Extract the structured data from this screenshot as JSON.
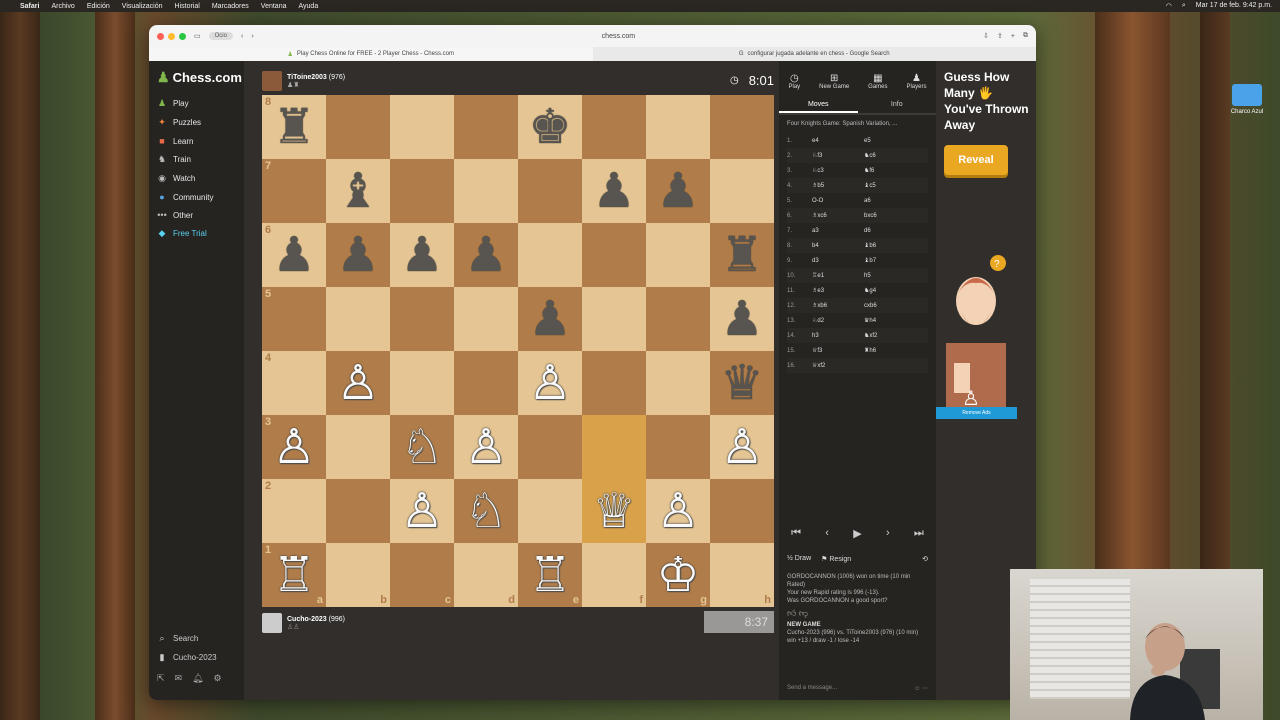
{
  "menubar": {
    "app": "Safari",
    "items": [
      "Archivo",
      "Edición",
      "Visualización",
      "Historial",
      "Marcadores",
      "Ventana",
      "Ayuda"
    ],
    "datetime": "Mar 17 de feb. 9:42 p.m."
  },
  "desktop": {
    "folder_label": "Charco Azul"
  },
  "browser": {
    "profile": "Ocio",
    "url": "chess.com",
    "tabs": [
      "Play Chess Online for FREE - 2 Player Chess - Chess.com",
      "configurar jugada adelante en chess - Google Search"
    ]
  },
  "sidebar": {
    "logo": "Chess.com",
    "items": [
      {
        "label": "Play",
        "icon": "play-icon"
      },
      {
        "label": "Puzzles",
        "icon": "puzzle-icon"
      },
      {
        "label": "Learn",
        "icon": "learn-icon"
      },
      {
        "label": "Train",
        "icon": "train-icon"
      },
      {
        "label": "Watch",
        "icon": "watch-icon"
      },
      {
        "label": "Community",
        "icon": "community-icon"
      },
      {
        "label": "Other",
        "icon": "more-icon"
      },
      {
        "label": "Free Trial",
        "icon": "diamond-icon"
      }
    ],
    "search": "Search",
    "user": "Cucho-2023"
  },
  "opponent": {
    "name": "TiToine2003",
    "rating": "(976)",
    "clock": "8:01"
  },
  "me": {
    "name": "Cucho-2023",
    "rating": "(996)",
    "clock": "8:37"
  },
  "board": {
    "highlight": [
      "f3",
      "f2"
    ],
    "files": [
      "a",
      "b",
      "c",
      "d",
      "e",
      "f",
      "g",
      "h"
    ],
    "ranks": [
      "8",
      "7",
      "6",
      "5",
      "4",
      "3",
      "2",
      "1"
    ],
    "pieces": {
      "a8": "bR",
      "e8": "bK",
      "b7": "bB",
      "f7": "bP",
      "g7": "bP",
      "a6": "bP",
      "b6": "bP",
      "c6": "bP",
      "d6": "bP",
      "h6": "bR",
      "e5": "bP",
      "h5": "bP",
      "b4": "wP",
      "e4": "wP",
      "h4": "bQ",
      "a3": "wP",
      "c3": "wN",
      "d3": "wP",
      "h3": "wP",
      "c2": "wP",
      "d2": "wN",
      "f2": "wQ",
      "g2": "wP",
      "a1": "wR",
      "e1": "wR",
      "g1": "wK"
    }
  },
  "panel": {
    "tabs": [
      {
        "label": "Play",
        "icon": "clock-icon"
      },
      {
        "label": "New Game",
        "icon": "plus-icon"
      },
      {
        "label": "Games",
        "icon": "games-icon"
      },
      {
        "label": "Players",
        "icon": "players-icon"
      }
    ],
    "subtabs": [
      "Moves",
      "Info"
    ],
    "opening": "Four Knights Game: Spanish Variation, ...",
    "moves": [
      {
        "n": "1.",
        "w": "e4",
        "b": "e5"
      },
      {
        "n": "2.",
        "w": "♘f3",
        "b": "♞c6"
      },
      {
        "n": "3.",
        "w": "♘c3",
        "b": "♞f6"
      },
      {
        "n": "4.",
        "w": "♗b5",
        "b": "♝c5"
      },
      {
        "n": "5.",
        "w": "O-O",
        "b": "a6"
      },
      {
        "n": "6.",
        "w": "♗xc6",
        "b": "bxc6"
      },
      {
        "n": "7.",
        "w": "a3",
        "b": "d6"
      },
      {
        "n": "8.",
        "w": "b4",
        "b": "♝b6"
      },
      {
        "n": "9.",
        "w": "d3",
        "b": "♝b7"
      },
      {
        "n": "10.",
        "w": "♖e1",
        "b": "h5"
      },
      {
        "n": "11.",
        "w": "♗e3",
        "b": "♞g4"
      },
      {
        "n": "12.",
        "w": "♗xb6",
        "b": "cxb6"
      },
      {
        "n": "13.",
        "w": "♘d2",
        "b": "♛h4"
      },
      {
        "n": "14.",
        "w": "h3",
        "b": "♞xf2"
      },
      {
        "n": "15.",
        "w": "♕f3",
        "b": "♜h6"
      },
      {
        "n": "16.",
        "w": "♕xf2",
        "b": ""
      }
    ],
    "draw": "Draw",
    "resign": "Resign",
    "chat": {
      "line1": "GORDOCANNON (1006) won on time (10 min Rated)",
      "line2": "Your new Rapid rating is 996 (-13).",
      "line3": "Was GORDOCANNON a good sport?",
      "new_game": "NEW GAME",
      "line4": "Cucho-2023 (996) vs. TiToine2003 (976) (10 min)",
      "line5": "win +13 / draw -1 / lose -14"
    },
    "send_placeholder": "Send a message..."
  },
  "ad": {
    "title": "Guess How Many 🖐 You've Thrown Away",
    "button": "Reveal",
    "remove": "Remove Ads"
  }
}
